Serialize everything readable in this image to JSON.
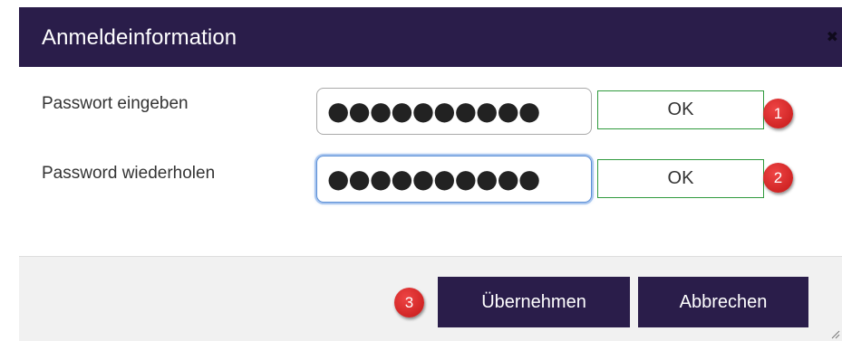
{
  "dialog": {
    "title": "Anmeldeinformation",
    "close_glyph": "✖"
  },
  "form": {
    "rows": [
      {
        "label": "Passwort eingeben",
        "value": "●●●●●●●●●●",
        "ok_label": "OK",
        "badge": "1"
      },
      {
        "label": "Password wiederholen",
        "value": "●●●●●●●●●●",
        "ok_label": "OK",
        "badge": "2"
      }
    ]
  },
  "footer": {
    "apply_label": "Übernehmen",
    "cancel_label": "Abbrechen",
    "apply_badge": "3"
  },
  "colors": {
    "titlebar": "#2a1d4a",
    "ok_border": "#2f9a3d",
    "badge": "#d42020",
    "focus": "#5b8fd6"
  }
}
